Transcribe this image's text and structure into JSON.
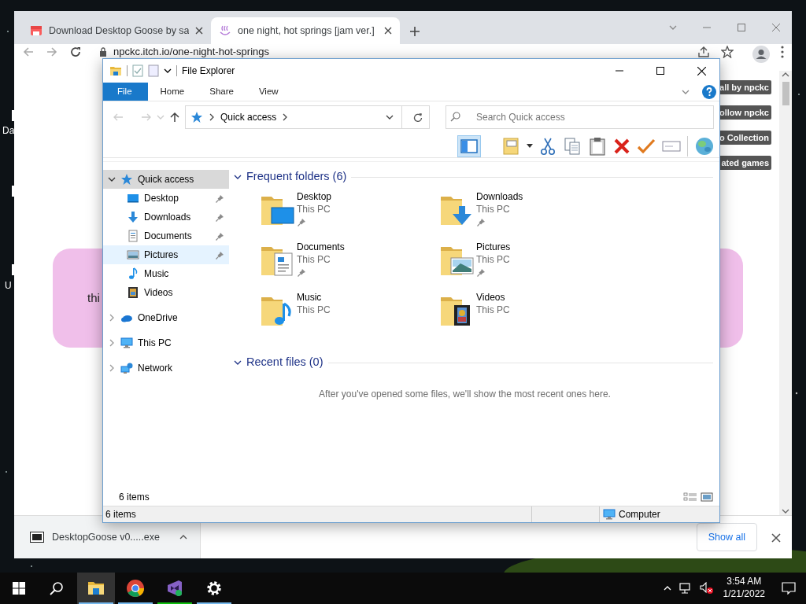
{
  "desktop": {
    "icon_labels": [
      "Da",
      "U"
    ]
  },
  "browser": {
    "tabs": [
      {
        "title": "Download Desktop Goose by sa",
        "kind": "itch",
        "selected": false
      },
      {
        "title": "one night, hot springs [jam ver.]",
        "kind": "springs",
        "selected": true
      }
    ],
    "address": "npckc.itch.io/one-night-hot-springs",
    "page_buttons": [
      "all by npckc",
      "ollow npckc",
      "o Collection",
      "ated games"
    ],
    "banner_text": "thi",
    "download": {
      "filename": "DesktopGoose v0.....exe"
    },
    "show_all": "Show all"
  },
  "explorer": {
    "title": "File Explorer",
    "ribbon_tabs": [
      {
        "label": "File",
        "selected": true
      },
      {
        "label": "Home",
        "selected": false
      },
      {
        "label": "Share",
        "selected": false
      },
      {
        "label": "View",
        "selected": false
      }
    ],
    "address": "Quick access",
    "search": {
      "placeholder": "Search Quick access"
    },
    "nav": [
      {
        "label": "Quick access",
        "kind": "star",
        "expanded": true,
        "selected": true,
        "hovered": false,
        "children": [
          {
            "label": "Desktop",
            "kind": "desktop",
            "pinned": true,
            "selected": false,
            "hovered": false
          },
          {
            "label": "Downloads",
            "kind": "downloads",
            "pinned": true,
            "selected": false,
            "hovered": false
          },
          {
            "label": "Documents",
            "kind": "documents",
            "pinned": true,
            "selected": false,
            "hovered": false
          },
          {
            "label": "Pictures",
            "kind": "pictures",
            "pinned": true,
            "selected": false,
            "hovered": true
          },
          {
            "label": "Music",
            "kind": "music",
            "pinned": false,
            "selected": false,
            "hovered": false
          },
          {
            "label": "Videos",
            "kind": "videos",
            "pinned": false,
            "selected": false,
            "hovered": false
          }
        ]
      },
      {
        "label": "OneDrive",
        "kind": "onedrive",
        "expanded": false,
        "selected": false,
        "hovered": false
      },
      {
        "label": "This PC",
        "kind": "thispc",
        "expanded": false,
        "selected": false,
        "hovered": false
      },
      {
        "label": "Network",
        "kind": "network",
        "expanded": false,
        "selected": false,
        "hovered": false
      }
    ],
    "sections": [
      {
        "title": "Frequent folders (6)",
        "expanded": true,
        "folders": [
          {
            "name": "Desktop",
            "location": "This PC",
            "kind": "desktop",
            "pinned": true
          },
          {
            "name": "Downloads",
            "location": "This PC",
            "kind": "downloads",
            "pinned": true
          },
          {
            "name": "Documents",
            "location": "This PC",
            "kind": "documents",
            "pinned": true
          },
          {
            "name": "Pictures",
            "location": "This PC",
            "kind": "pictures",
            "pinned": true
          },
          {
            "name": "Music",
            "location": "This PC",
            "kind": "music",
            "pinned": false
          },
          {
            "name": "Videos",
            "location": "This PC",
            "kind": "videos",
            "pinned": false
          }
        ]
      },
      {
        "title": "Recent files (0)",
        "expanded": true,
        "empty_text": "After you've opened some files, we'll show the most recent ones here."
      }
    ],
    "item_count": "6 items",
    "status_bar": {
      "items": "6 items",
      "location": "Computer"
    }
  },
  "taskbar": {
    "apps": [
      {
        "kind": "explorer",
        "active": true,
        "color": "#76b9ed"
      },
      {
        "kind": "chrome",
        "active": false,
        "color": "#76b9ed"
      },
      {
        "kind": "vs",
        "active": false,
        "color": "#10c010"
      },
      {
        "kind": "settings",
        "active": false,
        "color": "#76b9ed"
      }
    ],
    "time": "3:54 AM",
    "date": "1/21/2022"
  }
}
